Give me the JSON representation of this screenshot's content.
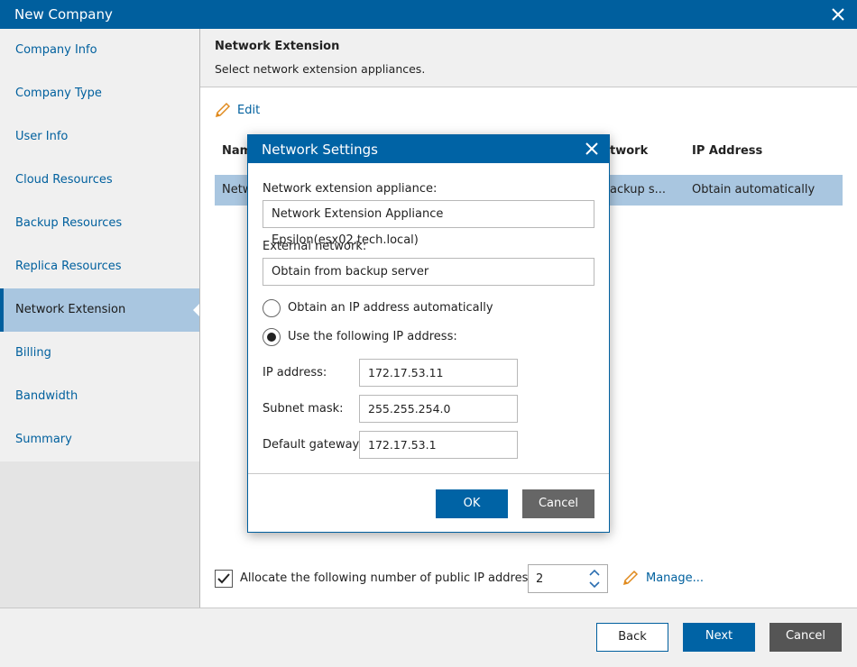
{
  "window": {
    "title": "New Company"
  },
  "sidebar": {
    "items": [
      {
        "label": "Company Info"
      },
      {
        "label": "Company Type"
      },
      {
        "label": "User Info"
      },
      {
        "label": "Cloud Resources"
      },
      {
        "label": "Backup Resources"
      },
      {
        "label": "Replica Resources"
      },
      {
        "label": "Network Extension",
        "active": true
      },
      {
        "label": "Billing"
      },
      {
        "label": "Bandwidth"
      },
      {
        "label": "Summary"
      }
    ]
  },
  "header": {
    "title": "Network Extension",
    "subtitle": "Select network extension appliances."
  },
  "toolbar": {
    "edit_label": "Edit"
  },
  "table": {
    "columns": [
      "Nam",
      "twork",
      "IP Address"
    ],
    "rows": [
      {
        "name": "Netw",
        "network": "ackup s...",
        "ip": "Obtain automatically"
      }
    ]
  },
  "allocate": {
    "checked": true,
    "label": "Allocate the following number of public IP addresses",
    "count": "2",
    "manage_label": "Manage..."
  },
  "footer": {
    "back_label": "Back",
    "next_label": "Next",
    "cancel_label": "Cancel"
  },
  "modal": {
    "title": "Network Settings",
    "appliance_label": "Network extension appliance:",
    "appliance_value": "Network Extension Appliance Epsilon(esx02.tech.local)",
    "external_label": "External network:",
    "external_value": "Obtain from backup server",
    "radio_auto_label": "Obtain an IP address automatically",
    "radio_manual_label": "Use the following IP address:",
    "selected_radio": "manual",
    "ip_label": "IP address:",
    "ip_value": "172.17.53.11",
    "subnet_label": "Subnet mask:",
    "subnet_value": "255.255.254.0",
    "gateway_label": "Default gateway:",
    "gateway_value": "172.17.53.1",
    "ok_label": "OK",
    "cancel_label": "Cancel"
  },
  "colors": {
    "accent": "#005f9e",
    "selection": "#a9c6e0",
    "link": "#00609e"
  }
}
